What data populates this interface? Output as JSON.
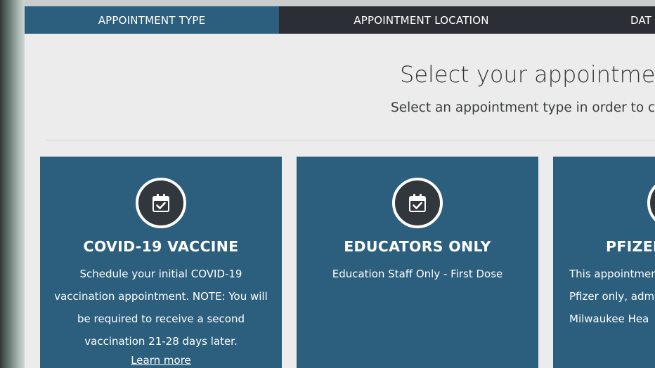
{
  "tabs": [
    {
      "label": "APPOINTMENT TYPE",
      "active": true
    },
    {
      "label": "APPOINTMENT LOCATION",
      "active": false
    },
    {
      "label": "DAT",
      "active": false
    }
  ],
  "page": {
    "heading": "Select your appointment t",
    "subheading": "Select an appointment type in order to co"
  },
  "cards": [
    {
      "icon": "calendar-check-icon",
      "title": "COVID-19 VACCINE",
      "description": "Schedule your initial COVID-19 vaccination appointment. NOTE: You will be required to receive a second vaccination 21-28 days later.",
      "link": "Learn more"
    },
    {
      "icon": "calendar-check-icon",
      "title": "EDUCATORS ONLY",
      "description": "Education Staff Only - First Dose"
    },
    {
      "icon": "calendar-check-icon",
      "title": "PFIZER",
      "lines": [
        "This appointmen",
        "Pfizer only, adm",
        "Milwaukee Hea"
      ]
    }
  ],
  "colors": {
    "active_tab": "#2c5f7e",
    "tab_bar": "#2b2f35",
    "card_background": "#2c5f7e",
    "icon_circle": "#31373d",
    "page_background": "#ececec"
  }
}
